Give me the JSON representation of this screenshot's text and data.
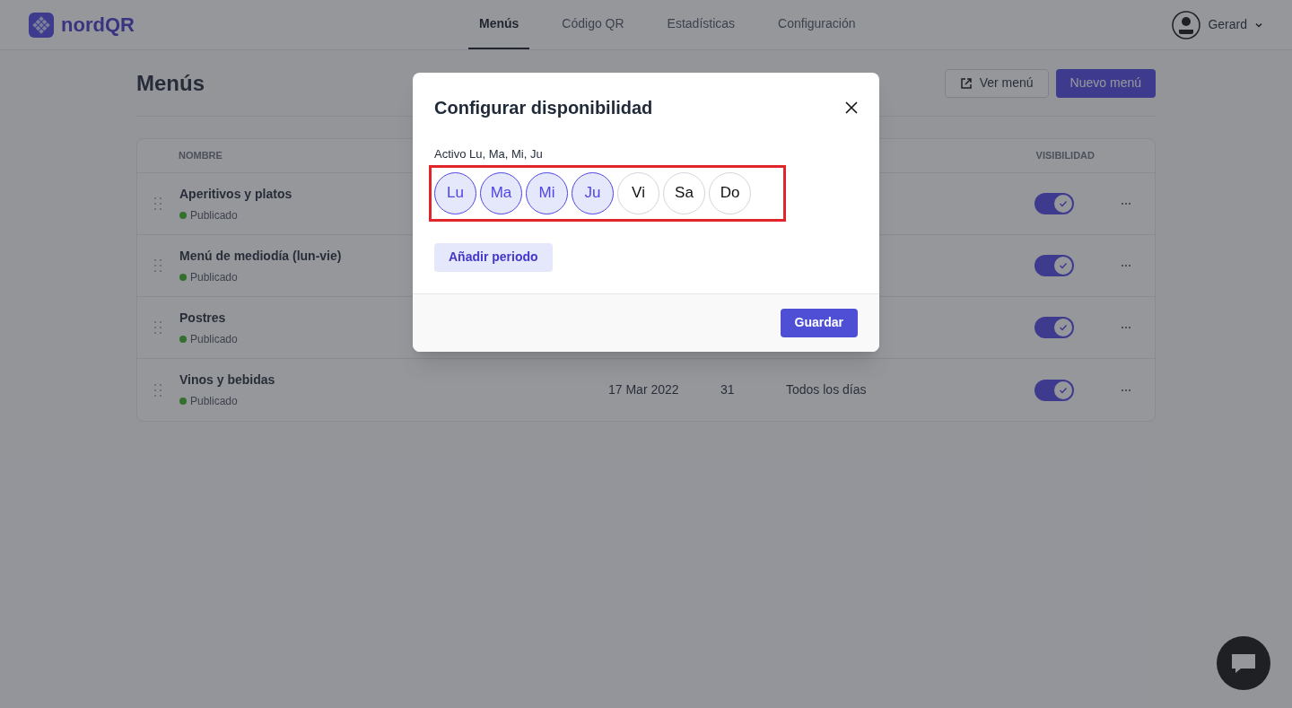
{
  "brand": "nordQR",
  "nav": [
    {
      "label": "Menús",
      "selected": true
    },
    {
      "label": "Código QR",
      "selected": false
    },
    {
      "label": "Estadísticas",
      "selected": false
    },
    {
      "label": "Configuración",
      "selected": false
    }
  ],
  "user": {
    "name": "Gerard"
  },
  "page": {
    "title": "Menús",
    "buttons": [
      {
        "label": "Ver menú",
        "kind": "secondary"
      },
      {
        "label": "Nuevo menú",
        "kind": "primary"
      }
    ]
  },
  "table": {
    "columns": [
      "NOMBRE",
      "VISIBILIDAD"
    ],
    "rows": [
      {
        "name": "Aperitivos y platos",
        "status": "Publicado",
        "color": "#33702d",
        "visible": true
      },
      {
        "name": "Menú de mediodía (lun-vie)",
        "status": "Publicado",
        "color": "#33702d",
        "visible": true
      },
      {
        "name": "Postres",
        "status": "Publicado",
        "color": "#33702d",
        "visible": true
      },
      {
        "name": "Vinos y bebidas",
        "status": "Publicado",
        "color": "#33702d",
        "date": "17 Mar 2022",
        "count": "31",
        "availability": "Todos los días",
        "visible": true
      }
    ]
  },
  "modal": {
    "title": "Configurar disponibilidad",
    "summary": "Activo Lu, Ma, Mi, Ju",
    "days": [
      {
        "label": "Lu",
        "selected": true
      },
      {
        "label": "Ma",
        "selected": true
      },
      {
        "label": "Mi",
        "selected": true
      },
      {
        "label": "Ju",
        "selected": true
      },
      {
        "label": "Vi",
        "selected": false
      },
      {
        "label": "Sa",
        "selected": false
      },
      {
        "label": "Do",
        "selected": false
      }
    ],
    "add_button": "Añadir periodo",
    "save_button": "Guardar"
  }
}
